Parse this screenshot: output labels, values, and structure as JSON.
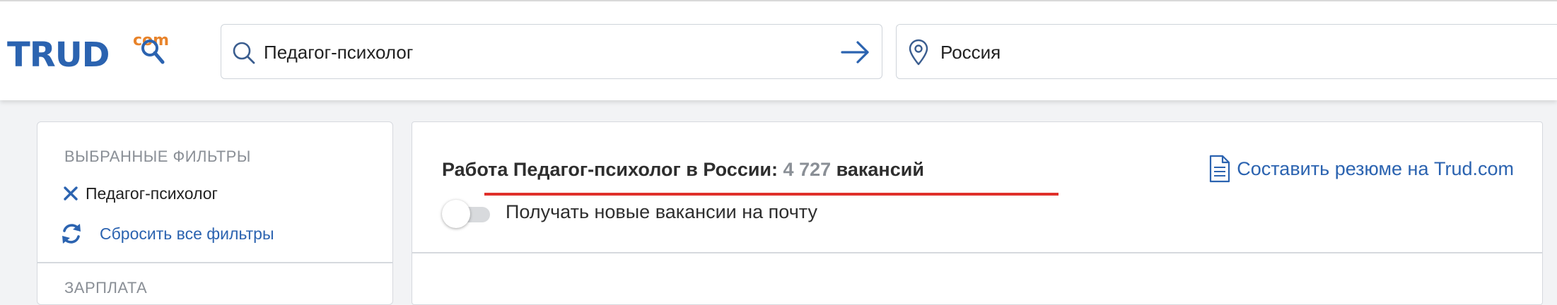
{
  "header": {
    "logo": {
      "text": "TRUD",
      "suffix": "com",
      "brand_color": "#2b63b0",
      "accent_color": "#e8832a"
    },
    "search": {
      "value": "Педагог-психолог",
      "icon": "search-icon",
      "submit_icon": "arrow-right-icon"
    },
    "location": {
      "value": "Россия",
      "icon": "map-pin-icon"
    }
  },
  "sidebar": {
    "title": "ВЫБРАННЫЕ ФИЛЬТРЫ",
    "chips": [
      {
        "label": "Педагог-психолог",
        "icon": "close-icon"
      }
    ],
    "reset_label": "Сбросить все фильтры",
    "next_section": "ЗАРПЛАТА"
  },
  "main": {
    "headline_prefix": "Работа Педагог-психолог в России:",
    "vacancy_count": "4 727",
    "headline_suffix": "вакансий",
    "subscribe_label": "Получать новые вакансии на почту",
    "subscribe_on": false,
    "resume_link": "Составить резюме на Trud.com"
  },
  "colors": {
    "link": "#2b63b0",
    "underline_accent": "#e0302a",
    "muted": "#8a8f96"
  }
}
